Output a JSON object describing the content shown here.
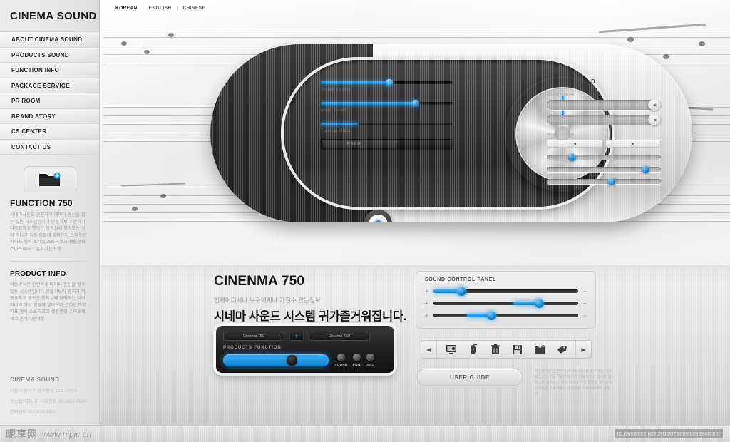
{
  "brand": {
    "title": "CINEMA SOUND"
  },
  "topnav": {
    "languages": [
      "KOREAN",
      "ENGLISH",
      "CHINESE"
    ],
    "separator": "|"
  },
  "sidebar": {
    "items": [
      {
        "label": "ABOUT CINEMA SOUND"
      },
      {
        "label": "PRODUCTS SOUND"
      },
      {
        "label": "FUNCTION INFO"
      },
      {
        "label": "PACKAGE SERVICE"
      },
      {
        "label": "PR ROOM"
      },
      {
        "label": "BRAND STORY"
      },
      {
        "label": "CS CENTER"
      },
      {
        "label": "CONTACT US"
      }
    ],
    "function_card": {
      "icon": "folder-add-icon",
      "title": "FUNCTION 750",
      "body": "시네마사운드 간편하게 데이터 통신을 할수 있는 시스템입니다 만들기보다 관리가 더중요하고 행복은 행복실때 찾아오는 것이 아니라 가장 힘들때 찾아온다 스마트한 라이프 행복 스타일 스토리로크 생활문화 스마트제테크 혼자가는여행"
    },
    "product_info": {
      "title": "PRODUCT INFO",
      "body": "이동방식은 간편하게 데이터 통신을 할수 있는 시스템입니다 만들기보다 관리가 더중요하고 행복은 행복실때 찾아오는 것이 아니라 가장 힘들때 찾아온다 스마트한 라이프 행복 스토리로크 생활문화 스마트제테크 혼자가는여행"
    },
    "footer": {
      "title": "CINEMA SOUND",
      "lines": [
        "서울시 강남구 압구정동 123-34번지",
        "윈스탑커뮤니티          대표전화  02-3920-5900",
        "문의센타 02-3920-5900"
      ]
    }
  },
  "hero": {
    "device": {
      "sliders": [
        {
          "label": "Sound Volume",
          "fill_pct": 52,
          "knob_pct": 52
        },
        {
          "label": "Music Select",
          "fill_pct": 72,
          "knob_pct": 72
        },
        {
          "label": "Tune up Music",
          "fill_pct": 28,
          "knob_pct": 0
        }
      ],
      "push_button": {
        "label": "PUSH"
      },
      "dial": {
        "name": "master-volume-dial",
        "angle_deg": 0
      },
      "power_button": {
        "name": "power-button"
      }
    },
    "panel": {
      "title": "CINEMA SOUND",
      "sound_volume_label": "Sound Volume",
      "pills": [
        {
          "cap_glyph": "◀"
        },
        {
          "cap_glyph": "◀"
        }
      ],
      "music_list_label": "Music List File",
      "prev_glyph": "◀",
      "next_glyph": "▶",
      "mini_sliders": [
        {
          "knob_pct": 22
        },
        {
          "knob_pct": 86
        },
        {
          "knob_pct": 56
        }
      ]
    }
  },
  "lower": {
    "promo": {
      "heading": "CINENMA 750",
      "subtitle": "언제어디서나 누구에게나 가질수 있는정보",
      "korean_headline": "시네마 사운드 시스템 귀가즐거워집니다."
    },
    "widget": {
      "select_left": "Cinema 750",
      "select_left_chevron": "↕",
      "plus_label": "+",
      "select_right": "Cinema 750",
      "function_label": "PRODUCTS FUNCTION",
      "slider_knob_pct": 60,
      "buttons": [
        {
          "label": "SOUND"
        },
        {
          "label": "FUN"
        },
        {
          "label": "INFO"
        }
      ]
    },
    "sound_control_panel": {
      "title": "SOUND CONTROL PANEL",
      "plus_sign": "+",
      "minus_sign": "–",
      "sliders": [
        {
          "fill_start_pct": 0,
          "fill_end_pct": 19,
          "knob_pct": 19
        },
        {
          "fill_start_pct": 55,
          "fill_end_pct": 73,
          "knob_pct": 73
        },
        {
          "fill_start_pct": 23,
          "fill_end_pct": 40,
          "knob_pct": 40
        }
      ]
    },
    "toolbar": {
      "prev_glyph": "◀",
      "next_glyph": "▶",
      "icons": [
        {
          "name": "monitor-icon"
        },
        {
          "name": "mouse-icon"
        },
        {
          "name": "trash-icon"
        },
        {
          "name": "save-icon"
        },
        {
          "name": "folder-icon"
        },
        {
          "name": "tag-icon"
        }
      ]
    },
    "user_guide_button": {
      "label": "USER GUIDE"
    },
    "right_text": "이동방식은 간편하게 데이터 통신을 할수 있는 시스템입니다 만들기보다 관리가 더중요하고 행복은 행복실때 찾아오는 것이 아니라 가장 힘들때 찾아온다 스마트한 스토리로크 생활문화 스마트제테크 혼자가"
  },
  "watermark": {
    "cn_name": "昵享网",
    "url": "www.nipic.cn",
    "id_text": "ID:6608733 NO:20130716091355940000"
  },
  "colors": {
    "accent_blue": "#1589d8",
    "dark_panel": "#272727",
    "metal_light": "#ededed"
  }
}
